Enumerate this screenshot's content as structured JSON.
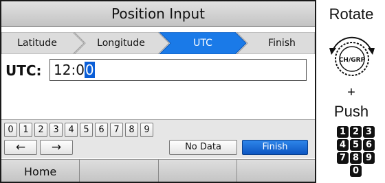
{
  "title": "Position Input",
  "steps": [
    {
      "label": "Latitude",
      "active": false
    },
    {
      "label": "Longitude",
      "active": false
    },
    {
      "label": "UTC",
      "active": true
    },
    {
      "label": "Finish",
      "active": false
    }
  ],
  "utc": {
    "label": "UTC:",
    "value_prefix": "12:0",
    "value_cursor_char": "0"
  },
  "keypad": {
    "digits": [
      "0",
      "1",
      "2",
      "3",
      "4",
      "5",
      "6",
      "7",
      "8",
      "9"
    ],
    "left_arrow": "←",
    "right_arrow": "→",
    "no_data_label": "No Data",
    "finish_label": "Finish"
  },
  "softkeys": [
    "Home",
    "",
    "",
    ""
  ],
  "side_panel": {
    "rotate_label": "Rotate",
    "knob_label": "CH/GRP",
    "plus": "+",
    "push_label": "Push",
    "digit_keys": [
      "1",
      "2",
      "3",
      "4",
      "5",
      "6",
      "7",
      "8",
      "9",
      "0"
    ]
  },
  "colors": {
    "active_step": "#1a7ae8",
    "finish_key": "#1a6fde",
    "cursor_highlight": "#0a5ed7"
  }
}
